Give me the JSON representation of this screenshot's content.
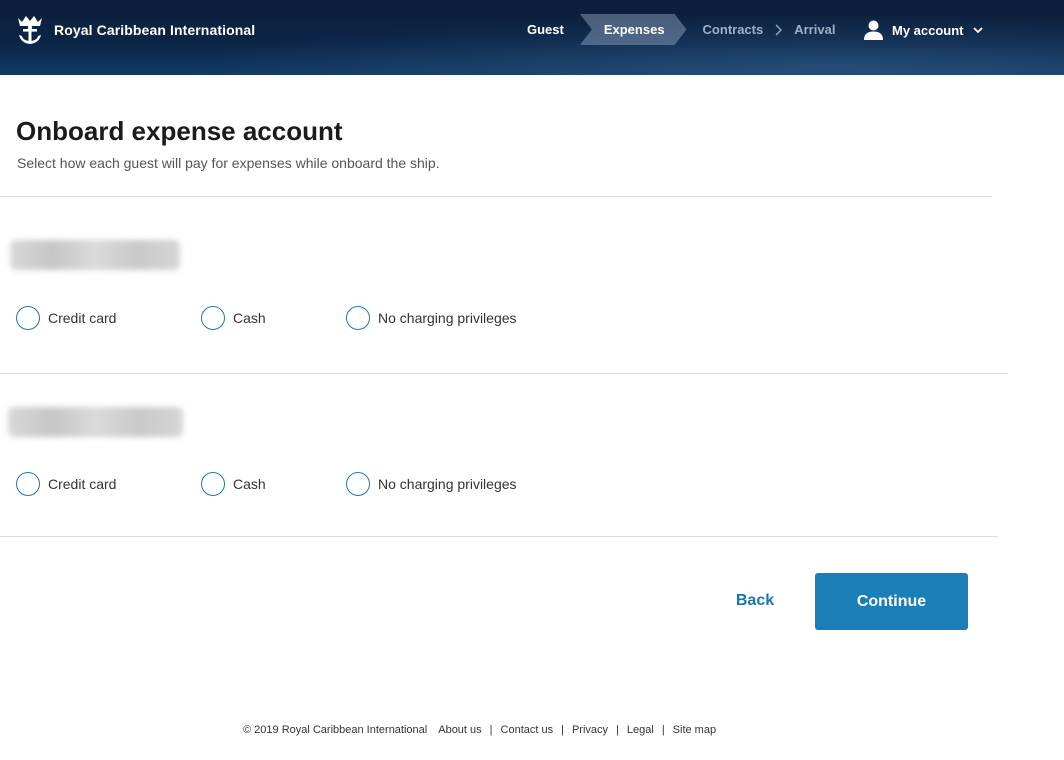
{
  "header": {
    "brand_name": "Royal Caribbean International",
    "logo_icon": "crown-anchor-logo",
    "steps": [
      {
        "label": "Guest",
        "state": "completed"
      },
      {
        "label": "Expenses",
        "state": "current"
      },
      {
        "label": "Contracts",
        "state": "upcoming"
      },
      {
        "label": "Arrival",
        "state": "upcoming"
      }
    ],
    "step_separator": ">",
    "account_label": "My account"
  },
  "main": {
    "title": "Onboard expense account",
    "subtitle": "Select how each guest will pay for expenses while onboard the ship.",
    "guests": [
      {
        "name_visible": false,
        "options": [
          "Credit card",
          "Cash",
          "No charging privileges"
        ],
        "selected": null
      },
      {
        "name_visible": false,
        "options": [
          "Credit card",
          "Cash",
          "No charging privileges"
        ],
        "selected": null
      }
    ]
  },
  "actions": {
    "back_label": "Back",
    "continue_label": "Continue"
  },
  "footer": {
    "copyright": "© 2019 Royal Caribbean International",
    "links": [
      "About us",
      "Contact us",
      "Privacy",
      "Legal",
      "Site map"
    ]
  },
  "colors": {
    "header_dark": "#0b2446",
    "accent_blue": "#1a7fb8",
    "radio_border": "#2174b8",
    "link_blue": "#1a74b4"
  }
}
